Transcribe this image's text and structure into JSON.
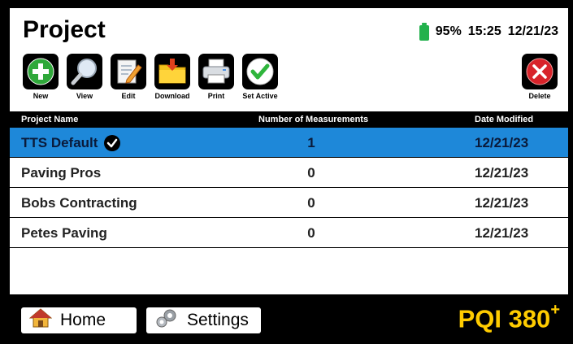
{
  "header": {
    "title": "Project",
    "battery_percent": "95%",
    "battery_level": 0.95,
    "time": "15:25",
    "date": "12/21/23"
  },
  "toolbar": {
    "new_label": "New",
    "view_label": "View",
    "edit_label": "Edit",
    "download_label": "Download",
    "print_label": "Print",
    "set_active_label": "Set Active",
    "delete_label": "Delete"
  },
  "table": {
    "columns": [
      "Project Name",
      "Number of Measurements",
      "Date Modified"
    ],
    "rows": [
      {
        "name": "TTS Default",
        "measurements": "1",
        "date": "12/21/23",
        "active": true
      },
      {
        "name": "Paving Pros",
        "measurements": "0",
        "date": "12/21/23",
        "active": false
      },
      {
        "name": "Bobs Contracting",
        "measurements": "0",
        "date": "12/21/23",
        "active": false
      },
      {
        "name": "Petes Paving",
        "measurements": "0",
        "date": "12/21/23",
        "active": false
      }
    ]
  },
  "bottom": {
    "home_label": "Home",
    "settings_label": "Settings",
    "brand": "PQI 380",
    "brand_sup": "+"
  },
  "colors": {
    "selected_row": "#1e88d9",
    "battery": "#22b14c",
    "brand": "#ffcc00",
    "delete_red": "#d8232a"
  }
}
